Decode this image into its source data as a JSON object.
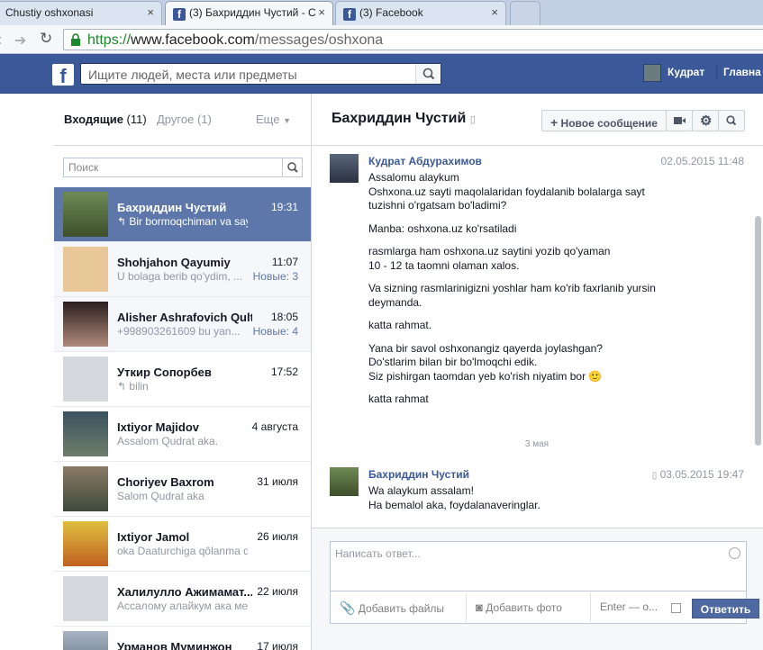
{
  "browser": {
    "tabs": [
      {
        "title": "Chustiy oshxonasi"
      },
      {
        "title": "(3) Бахриддин Чустий - С"
      },
      {
        "title": "(3) Facebook"
      }
    ],
    "url_scheme": "https://",
    "url_host": "www.facebook.com",
    "url_path": "/messages/oshxona"
  },
  "fbbar": {
    "search_placeholder": "Ищите людей, места или предметы",
    "user_name": "Кудрат",
    "home_label": "Главна"
  },
  "sidebar": {
    "inbox_label": "Входящие",
    "inbox_count": "(11)",
    "other_label": "Другое",
    "other_count": "(1)",
    "more_label": "Еще",
    "search_placeholder": "Поиск",
    "threads": [
      {
        "name": "Бахриддин Чустий",
        "time": "19:31",
        "preview": "↰ Bir bormoqchiman va sayt...",
        "new": ""
      },
      {
        "name": "Shohjahon Qayumiy",
        "time": "11:07",
        "preview": "U bolaga berib qo'ydim, ...",
        "new": "Новые: 3"
      },
      {
        "name": "Alisher Ashrafovich Qult...",
        "time": "18:05",
        "preview": "+998903261609 bu yan...",
        "new": "Новые: 4"
      },
      {
        "name": "Уткир Сопорбев",
        "time": "17:52",
        "preview": "↰ bilin",
        "new": ""
      },
      {
        "name": "Ixtiyor Majidov",
        "time": "4 августа",
        "preview": "Assalom Qudrat aka.",
        "new": ""
      },
      {
        "name": "Choriyev Baxrom",
        "time": "31 июля",
        "preview": "Salom Qudrat aka",
        "new": ""
      },
      {
        "name": "Ixtiyor Jamol",
        "time": "26 июля",
        "preview": "oka Daaturchiga qôlanma di...",
        "new": ""
      },
      {
        "name": "Халилулло Ажимамат...",
        "time": "22 июля",
        "preview": "Ассалому алайкум ака мен ...",
        "new": ""
      },
      {
        "name": "Урманов Муминжон",
        "time": "17 июля",
        "preview": "",
        "new": ""
      }
    ]
  },
  "conversation": {
    "title": "Бахриддин Чустий",
    "new_message_label": "Новое сообщение",
    "messages": [
      {
        "author": "Кудрат Абдурахимов",
        "date": "02.05.2015 11:48",
        "paragraphs": [
          "Assalomu alaykum",
          "Oshxona.uz sayti maqolalaridan foydalanib bolalarga sayt",
          "tuzishni o'rgatsam bo'ladimi?",
          "Manba: oshxona.uz ko'rsatiladi",
          "rasmlarga ham oshxona.uz saytini yozib qo'yaman",
          "10 - 12 ta taomni olaman xalos.",
          "Va sizning rasmlarinigizni yoshlar ham ko'rib faxrlanib yursin",
          "deymanda.",
          "katta rahmat.",
          "Yana bir savol oshxonangiz qayerda joylashgan?",
          "Do'stlarim bilan bir bo'lmoqchi edik.",
          "Siz pishirgan taomdan yeb ko'rish niyatim bor 🙂",
          "katta rahmat"
        ]
      },
      {
        "author": "Бахриддин Чустий",
        "date": "03.05.2015 19:47",
        "paragraphs": [
          "Wa alaykum assalam!",
          "Ha bemalol aka, foydalanaveringlar."
        ]
      }
    ],
    "day_separator": "3 мая",
    "reply_placeholder": "Написать ответ...",
    "add_files_label": "Добавить файлы",
    "add_photo_label": "Добавить фото",
    "enter_label": "Enter — о...",
    "send_label": "Ответить"
  }
}
